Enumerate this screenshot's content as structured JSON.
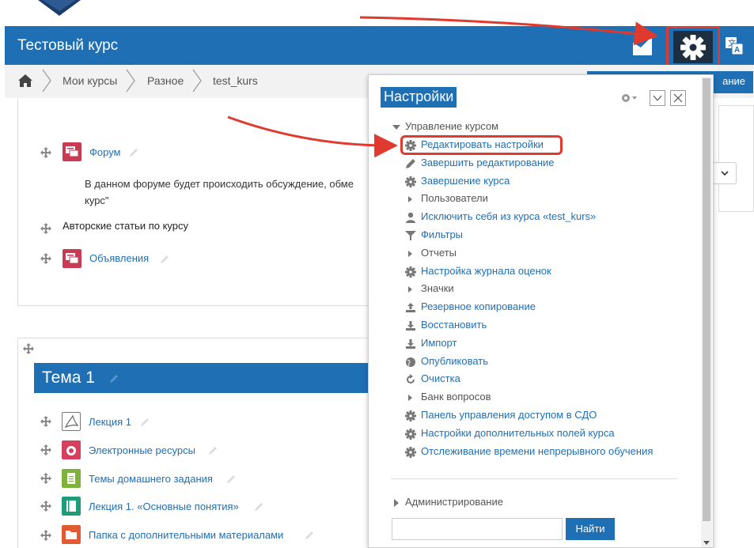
{
  "header": {
    "course_title": "Тестовый курс"
  },
  "breadcrumb": {
    "items": [
      "Мои курсы",
      "Разное",
      "test_kurs"
    ],
    "right_button_fragment": "ание"
  },
  "section0": {
    "activities": [
      {
        "label": "Форум",
        "icon": "forum-icon"
      },
      {
        "description_line1": "В данном форуме будет происходить обсуждение, обме",
        "description_line2": "курс\""
      },
      {
        "label": "Авторские статьи по курсу"
      },
      {
        "label": "Объявления",
        "icon": "forum-icon"
      }
    ]
  },
  "topic1": {
    "title": "Тема 1",
    "activities": [
      {
        "label": "Лекция 1",
        "icon": "pdf-icon"
      },
      {
        "label": "Электронные ресурсы",
        "icon": "url-icon"
      },
      {
        "label": "Темы домашнего задания",
        "icon": "page-icon"
      },
      {
        "label": "Лекция 1. «Основные понятия»",
        "icon": "book-icon"
      },
      {
        "label": "Папка с дополнительными материалами",
        "icon": "folder-icon"
      }
    ]
  },
  "settings": {
    "title": "Настройки",
    "root": "Управление курсом",
    "items": [
      {
        "label": "Редактировать настройки",
        "icon": "gear-icon"
      },
      {
        "label": "Завершить редактирование",
        "icon": "pencil-icon"
      },
      {
        "label": "Завершение курса",
        "icon": "gear-icon"
      },
      {
        "label": "Пользователи",
        "icon": "caret-right-icon"
      },
      {
        "label": "Исключить себя из курса «test_kurs»",
        "icon": "user-icon"
      },
      {
        "label": "Фильтры",
        "icon": "filter-icon"
      },
      {
        "label": "Отчеты",
        "icon": "caret-right-icon"
      },
      {
        "label": "Настройка журнала оценок",
        "icon": "gear-icon"
      },
      {
        "label": "Значки",
        "icon": "caret-right-icon"
      },
      {
        "label": "Резервное копирование",
        "icon": "upload-icon"
      },
      {
        "label": "Восстановить",
        "icon": "download-icon"
      },
      {
        "label": "Импорт",
        "icon": "download-icon"
      },
      {
        "label": "Опубликовать",
        "icon": "globe-icon"
      },
      {
        "label": "Очистка",
        "icon": "refresh-icon"
      },
      {
        "label": "Банк вопросов",
        "icon": "caret-right-icon"
      },
      {
        "label": "Панель управления доступом в СДО",
        "icon": "gear-icon"
      },
      {
        "label": "Настройки дополнительных полей курса",
        "icon": "gear-icon"
      },
      {
        "label": "Отслеживание времени непрерывного обучения",
        "icon": "gear-icon"
      }
    ],
    "admin_label": "Администрирование",
    "search_button": "Найти",
    "search_value": ""
  },
  "colors": {
    "brand_blue": "#1f6fb5",
    "highlight_red": "#e03a2f"
  }
}
